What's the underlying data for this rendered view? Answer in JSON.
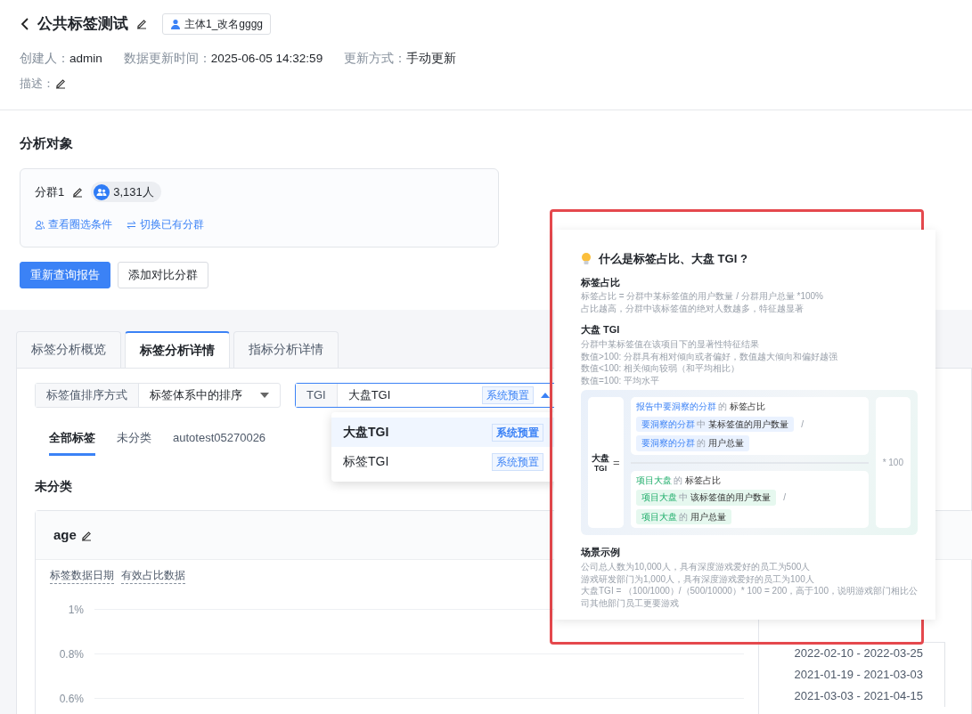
{
  "header": {
    "title": "公共标签测试",
    "subject_tag": "主体1_改名gggg",
    "meta": [
      {
        "label": "创建人：",
        "value": "admin"
      },
      {
        "label": "数据更新时间：",
        "value": "2025-06-05 14:32:59"
      },
      {
        "label": "更新方式：",
        "value": "手动更新"
      }
    ],
    "description_label": "描述："
  },
  "analysis": {
    "heading": "分析对象",
    "segment": {
      "name": "分群1",
      "count": "3,131人",
      "links": [
        {
          "label": "查看圈选条件",
          "kind": "user"
        },
        {
          "label": "切换已有分群",
          "kind": "swap"
        }
      ]
    },
    "buttons": [
      {
        "label": "重新查询报告",
        "kind": "primary"
      },
      {
        "label": "添加对比分群",
        "kind": "outline"
      }
    ]
  },
  "tabs": [
    {
      "label": "标签分析概览",
      "selected": false
    },
    {
      "label": "标签分析详情",
      "selected": true
    },
    {
      "label": "指标分析详情",
      "selected": false
    }
  ],
  "filters": {
    "sort": {
      "label": "标签值排序方式",
      "value": "标签体系中的排序"
    },
    "tgi": {
      "label": "TGI",
      "value": "大盘TGI",
      "badge": "系统预置",
      "expanded": true
    }
  },
  "dropdown": [
    {
      "label": "大盘TGI",
      "badge": "系统预置",
      "selected": true
    },
    {
      "label": "标签TGI",
      "badge": "系统预置",
      "selected": false
    }
  ],
  "category_tabs": [
    {
      "label": "全部标签",
      "selected": true
    },
    {
      "label": "未分类",
      "selected": false
    },
    {
      "label": "autotest05270026",
      "selected": false
    }
  ],
  "section_title": "未分类",
  "chart_card": {
    "title": "age",
    "toggles": [
      "标签数据日期",
      "有效占比数据"
    ],
    "y_ticks": [
      "1%",
      "0.8%",
      "0.6%"
    ]
  },
  "date_ranges": [
    "2022-02-10 - 2022-03-25",
    "2021-01-19 - 2021-03-03",
    "2021-03-03 - 2021-04-15"
  ],
  "popover": {
    "title": "什么是标签占比、大盘 TGI ?",
    "highlighted": true,
    "sections": [
      {
        "heading": "标签占比",
        "lines": [
          "标签占比 = 分群中某标签值的用户数量 / 分群用户总量 *100%",
          "占比越高，分群中该标签值的绝对人数越多，特征越显著"
        ]
      },
      {
        "heading": "大盘 TGI",
        "lines": [
          "分群中某标签值在该项目下的显著性特征结果",
          "数值>100: 分群具有相对倾向或者偏好，数值越大倾向和偏好越强",
          "数值<100: 相关倾向较弱（和平均相比）",
          "数值=100: 平均水平"
        ]
      }
    ],
    "formula": {
      "lhs": "大盘",
      "lhs_sub": "TGI",
      "equals": "=",
      "multiplier": "* 100",
      "parts": [
        {
          "kind": "segment",
          "title": [
            {
              "text": "报告中要洞察的分群",
              "kind": "subject"
            },
            {
              "text": "的",
              "kind": "connector"
            },
            {
              "text": "标签占比",
              "kind": "term"
            }
          ],
          "chips": [
            [
              {
                "text": "要洞察的分群",
                "kind": "subject"
              },
              {
                "text": "中",
                "kind": "connector"
              },
              {
                "text": "某标签值的用户数量",
                "kind": "term"
              }
            ],
            [
              {
                "text": "要洞察的分群",
                "kind": "subject"
              },
              {
                "text": "的",
                "kind": "connector"
              },
              {
                "text": "用户总量",
                "kind": "term"
              }
            ]
          ],
          "divider": "/"
        },
        {
          "kind": "market",
          "title": [
            {
              "text": "项目大盘",
              "kind": "subject"
            },
            {
              "text": "的",
              "kind": "connector"
            },
            {
              "text": "标签占比",
              "kind": "term"
            }
          ],
          "chips": [
            [
              {
                "text": "项目大盘",
                "kind": "subject"
              },
              {
                "text": "中",
                "kind": "connector"
              },
              {
                "text": "该标签值的用户数量",
                "kind": "term"
              }
            ],
            [
              {
                "text": "项目大盘",
                "kind": "subject"
              },
              {
                "text": "的",
                "kind": "connector"
              },
              {
                "text": "用户总量",
                "kind": "term"
              }
            ]
          ],
          "divider": "/"
        }
      ]
    },
    "example": {
      "heading": "场景示例",
      "lines": [
        "公司总人数为10,000人，具有深度游戏爱好的员工为500人",
        "游戏研发部门为1,000人，具有深度游戏爱好的员工为100人",
        "大盘TGI = （100/1000）/（500/10000）* 100 = 200，高于100，说明游戏部门相比公司其他部门员工更要游戏"
      ]
    }
  }
}
